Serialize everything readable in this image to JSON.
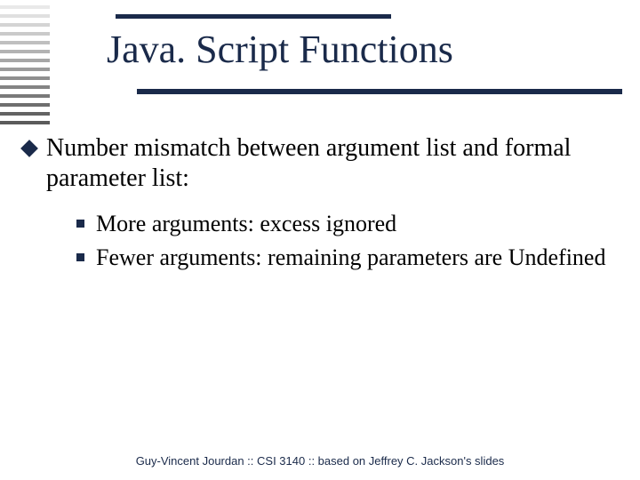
{
  "title": "Java. Script Functions",
  "bullets": {
    "lvl1": "Number mismatch between argument list and formal parameter list:",
    "lvl2": [
      "More arguments: excess ignored",
      "Fewer arguments: remaining parameters are Undefined"
    ]
  },
  "footer": "Guy-Vincent Jourdan :: CSI 3140 :: based on Jeffrey C. Jackson's slides"
}
